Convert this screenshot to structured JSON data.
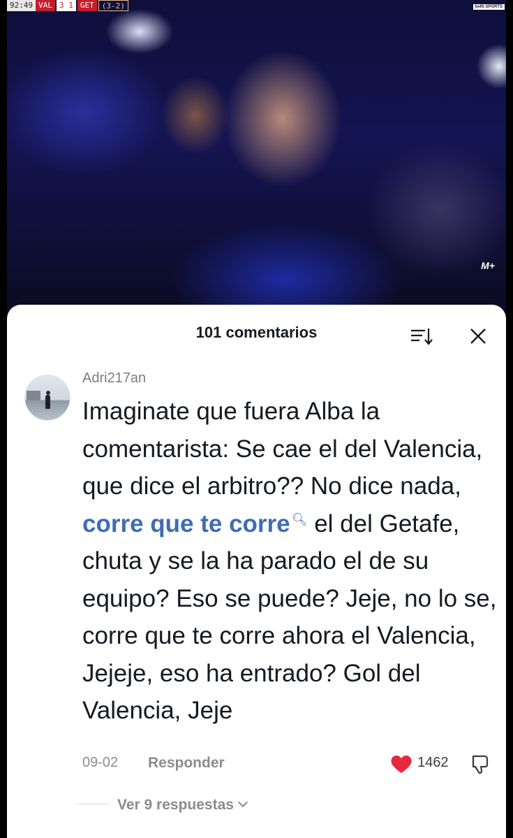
{
  "video": {
    "scorebug": {
      "time": "92:49",
      "team1": "VAL",
      "score": "3 1",
      "team2": "GET",
      "aggregate": "(3-2)"
    },
    "broadcaster": "beIN SPORTS",
    "watermark": "M+"
  },
  "comments": {
    "title": "101 comentarios",
    "comment": {
      "username": "Adri217an",
      "text_before": "Imaginate que fuera Alba la comentarista: Se cae el del Valencia, que dice el arbitro?? No dice nada, ",
      "link_text": "corre que te corre",
      "text_after": " el del Getafe, chuta y se la ha parado el de su equipo? Eso se puede? Jeje, no lo se, corre que te corre ahora el Valencia, Jejeje, eso ha entrado? Gol del Valencia, Jeje",
      "date": "09-02",
      "reply_label": "Responder",
      "likes": "1462",
      "view_replies": "Ver 9 respuestas"
    },
    "colors": {
      "heart": "#e8283f",
      "link": "#3f6cb5"
    }
  }
}
